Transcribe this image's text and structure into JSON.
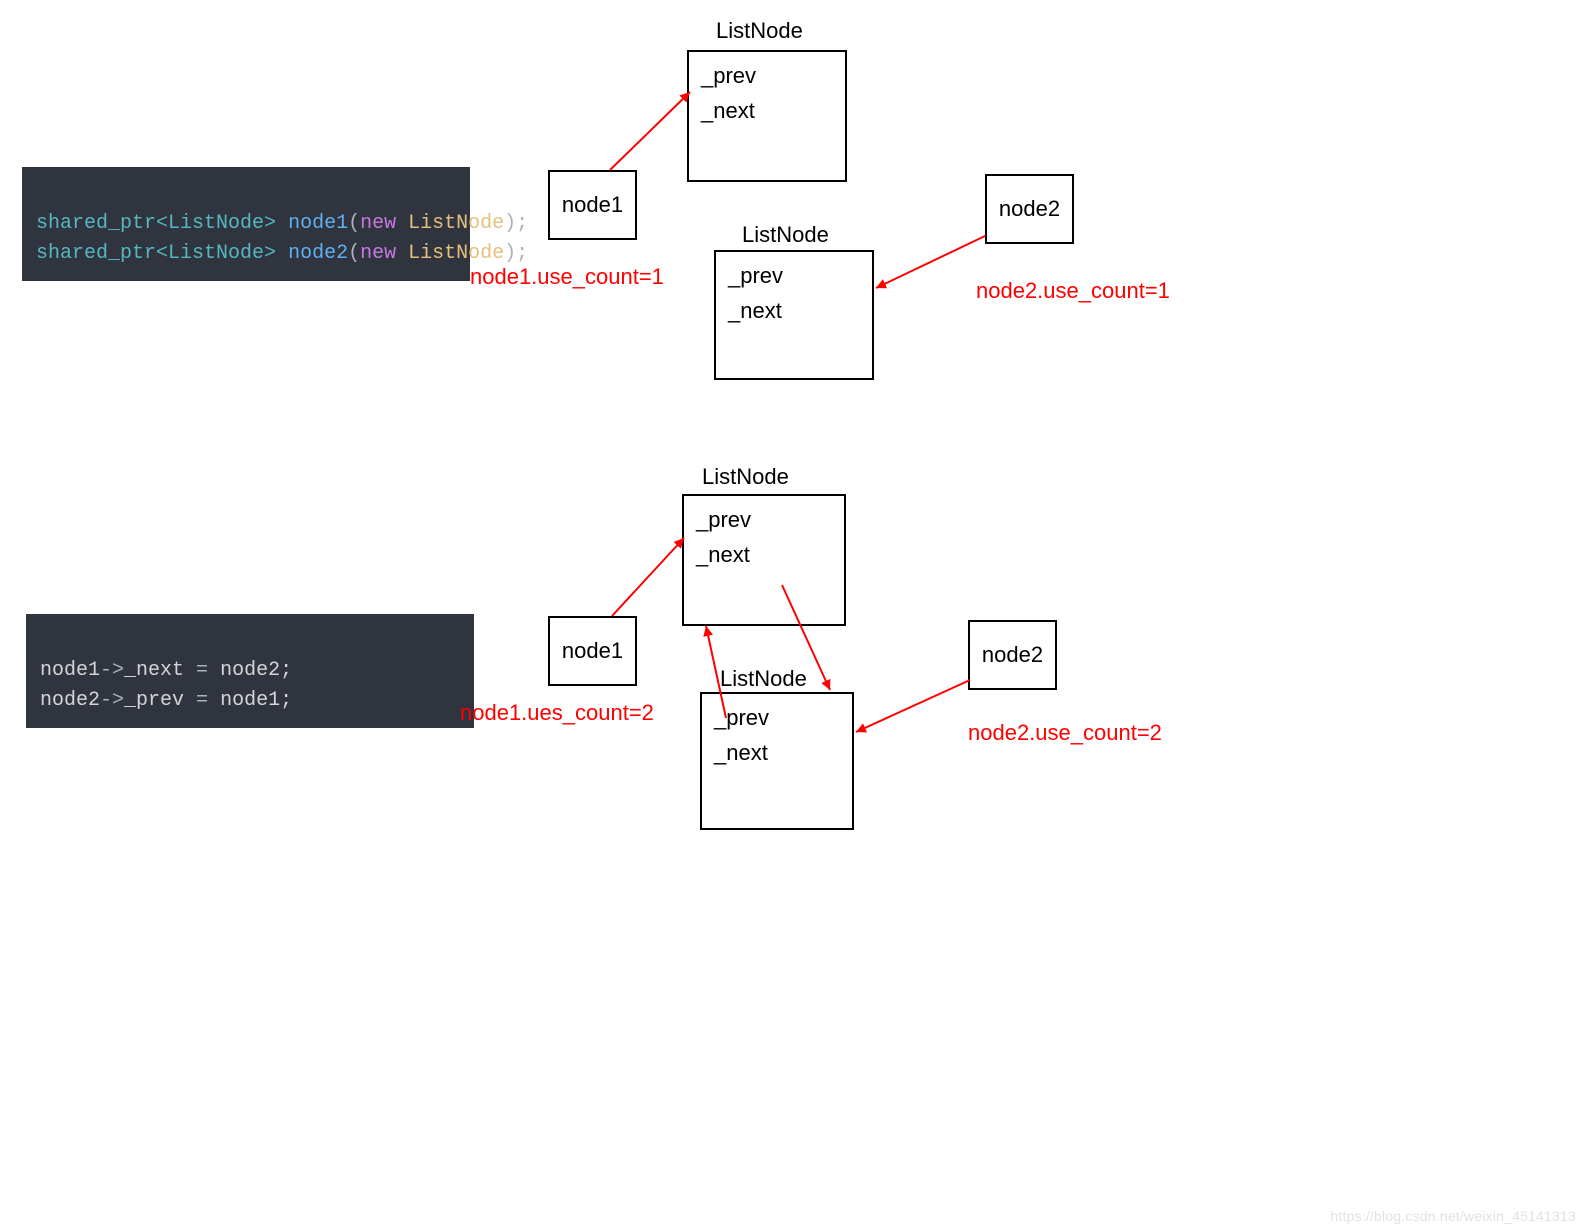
{
  "code": {
    "block1": {
      "line1_type": "shared_ptr",
      "line1_tpl": "<ListNode>",
      "line1_var": "node1",
      "line1_new": "new",
      "line1_cls": "ListNode",
      "line2_type": "shared_ptr",
      "line2_tpl": "<ListNode>",
      "line2_var": "node2",
      "line2_new": "new",
      "line2_cls": "ListNode"
    },
    "block2": {
      "line1_lhs": "node1",
      "line1_arrow": "->",
      "line1_member": "_next",
      "line1_eq": " = ",
      "line1_rhs": "node2;",
      "line2_lhs": "node2",
      "line2_arrow": "->",
      "line2_member": "_prev",
      "line2_eq": " = ",
      "line2_rhs": "node1;"
    }
  },
  "diagram1": {
    "title_top": "ListNode",
    "title_bottom": "ListNode",
    "node1_label": "node1",
    "node2_label": "node2",
    "struct_top_prev": "_prev",
    "struct_top_next": "_next",
    "struct_bot_prev": "_prev",
    "struct_bot_next": "_next",
    "node1_count": "node1.use_count=1",
    "node2_count": "node2.use_count=1"
  },
  "diagram2": {
    "title_top": "ListNode",
    "title_bottom": "ListNode",
    "node1_label": "node1",
    "node2_label": "node2",
    "struct_top_prev": "_prev",
    "struct_top_next": "_next",
    "struct_bot_prev": "_prev",
    "struct_bot_next": "_next",
    "node1_count": "node1.ues_count=2",
    "node2_count": "node2.use_count=2"
  },
  "watermark": "https://blog.csdn.net/weixin_45141313"
}
